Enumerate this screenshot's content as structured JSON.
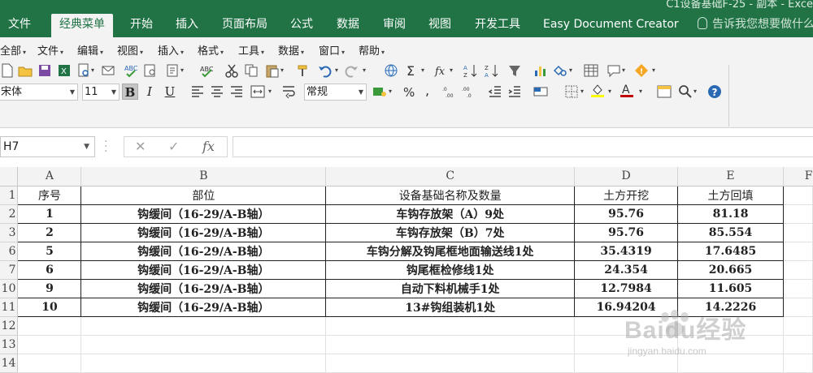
{
  "window": {
    "title": "C1设备基础F-25 - 副本 - Exce"
  },
  "tabs": [
    {
      "label": "文件"
    },
    {
      "label": "经典菜单"
    },
    {
      "label": "开始"
    },
    {
      "label": "插入"
    },
    {
      "label": "页面布局"
    },
    {
      "label": "公式"
    },
    {
      "label": "数据"
    },
    {
      "label": "审阅"
    },
    {
      "label": "视图"
    },
    {
      "label": "开发工具"
    },
    {
      "label": "Easy Document Creator"
    }
  ],
  "active_tab": "经典菜单",
  "tell_me": {
    "placeholder": "告诉我您想要做什么"
  },
  "classic_menu": [
    {
      "label": "全部"
    },
    {
      "label": "文件"
    },
    {
      "label": "编辑"
    },
    {
      "label": "视图"
    },
    {
      "label": "插入"
    },
    {
      "label": "格式"
    },
    {
      "label": "工具"
    },
    {
      "label": "数据"
    },
    {
      "label": "窗口"
    },
    {
      "label": "帮助"
    }
  ],
  "toolbar": {
    "font_name": "宋体",
    "font_size": "11",
    "bold_label": "B",
    "italic_label": "I",
    "underline_label": "U",
    "number_format": "常规"
  },
  "formula_bar": {
    "name_box": "H7",
    "cancel_symbol": "✕",
    "enter_symbol": "✓",
    "fx_symbol": "fx",
    "value": ""
  },
  "sheet": {
    "column_headers": [
      "A",
      "B",
      "C",
      "D",
      "E",
      "F"
    ],
    "rows": [
      {
        "row": "1",
        "cells": [
          "序号",
          "部位",
          "设备基础名称及数量",
          "土方开挖",
          "土方回填"
        ],
        "bold": false
      },
      {
        "row": "2",
        "cells": [
          "1",
          "钩缓间（16-29/A-B轴）",
          "车钩存放架（A）9处",
          "95.76",
          "81.18"
        ],
        "bold": true
      },
      {
        "row": "3",
        "cells": [
          "2",
          "钩缓间（16-29/A-B轴）",
          "车钩存放架（B）7处",
          "95.76",
          "85.554"
        ],
        "bold": true
      },
      {
        "row": "6",
        "cells": [
          "5",
          "钩缓间（16-29/A-B轴）",
          "车钩分解及钩尾框地面输送线1处",
          "35.4319",
          "17.6485"
        ],
        "bold": true
      },
      {
        "row": "7",
        "cells": [
          "6",
          "钩缓间（16-29/A-B轴）",
          "钩尾框检修线1处",
          "24.354",
          "20.665"
        ],
        "bold": true
      },
      {
        "row": "10",
        "cells": [
          "9",
          "钩缓间（16-29/A-B轴）",
          "自动下料机械手1处",
          "12.7984",
          "11.605"
        ],
        "bold": true
      },
      {
        "row": "11",
        "cells": [
          "10",
          "钩缓间（16-29/A-B轴）",
          "13#钩组装机1处",
          "16.94204",
          "14.2226"
        ],
        "bold": true
      },
      {
        "row": "12",
        "cells": [
          "",
          "",
          "",
          "",
          ""
        ],
        "bold": false
      },
      {
        "row": "13",
        "cells": [
          "",
          "",
          "",
          "",
          ""
        ],
        "bold": false
      },
      {
        "row": "14",
        "cells": [
          "",
          "",
          "",
          "",
          ""
        ],
        "bold": false
      }
    ]
  },
  "watermark": {
    "main": "Baidu经验",
    "sub": "jingyan.baidu.com"
  },
  "colors": {
    "excel_green": "#217346",
    "ribbon_bg": "#f3f3f3",
    "font_color_accent": "#c00000",
    "highlight_yellow": "#ffff00"
  }
}
